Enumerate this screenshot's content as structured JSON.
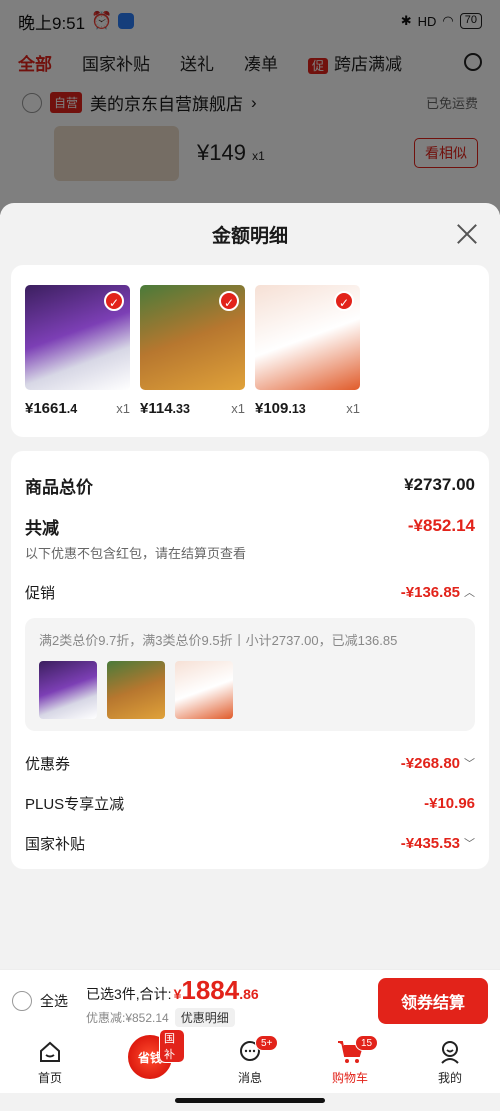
{
  "status_bar": {
    "time": "晚上9:51",
    "battery": "70",
    "signal": "HD"
  },
  "top_tabs": [
    {
      "label": "全部",
      "active": true
    },
    {
      "label": "国家补贴",
      "active": false
    },
    {
      "label": "送礼",
      "active": false
    },
    {
      "label": "凑单",
      "active": false
    },
    {
      "label": "跨店满减",
      "active": false,
      "tag": "促"
    }
  ],
  "shop": {
    "self_tag": "自营",
    "name": "美的京东自营旗舰店",
    "shipping": "已免运费"
  },
  "bg_item": {
    "price_symbol": "¥",
    "price": "149",
    "qty": "x1",
    "similar_label": "看相似"
  },
  "sheet": {
    "title": "金额明细",
    "products": [
      {
        "price_int": "¥1661",
        "price_dec": ".4",
        "qty": "x1"
      },
      {
        "price_int": "¥114",
        "price_dec": ".33",
        "qty": "x1"
      },
      {
        "price_int": "¥109",
        "price_dec": ".13",
        "qty": "x1"
      }
    ],
    "total_label": "商品总价",
    "total_value": "¥2737.00",
    "reduce_label": "共减",
    "reduce_value": "-¥852.14",
    "reduce_note": "以下优惠不包含红包，请在结算页查看",
    "promo_label": "促销",
    "promo_value": "-¥136.85",
    "promo_detail": "满2类总价9.7折，满3类总价9.5折丨小计2737.00，已减136.85",
    "coupon_label": "优惠券",
    "coupon_value": "-¥268.80",
    "plus_label": "PLUS专享立减",
    "plus_value": "-¥10.96",
    "subsidy_label": "国家补贴",
    "subsidy_value": "-¥435.53"
  },
  "bottom_bar": {
    "select_all": "全选",
    "selected_summary": "已选3件,合计:",
    "currency": "¥",
    "total_int": "1884",
    "total_dec": ".86",
    "discount": "优惠减:¥852.14",
    "detail_tag": "优惠明细",
    "checkout": "领券结算"
  },
  "nav": [
    {
      "label": "首页",
      "icon": "home-icon"
    },
    {
      "label": "省钱",
      "icon": "save-money-icon",
      "tag": "国补"
    },
    {
      "label": "消息",
      "icon": "message-icon",
      "badge": "5+"
    },
    {
      "label": "购物车",
      "icon": "cart-icon",
      "badge": "15",
      "active": true
    },
    {
      "label": "我的",
      "icon": "profile-icon"
    }
  ]
}
